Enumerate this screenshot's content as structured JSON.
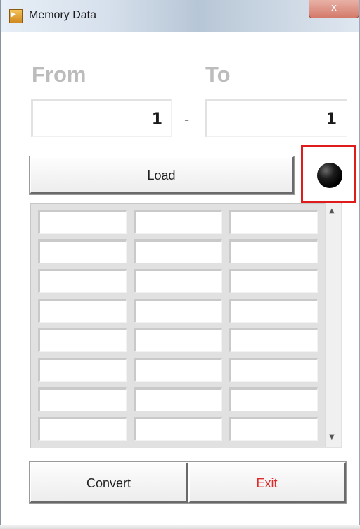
{
  "window": {
    "title": "Memory Data",
    "close_symbol": "x",
    "icon_glyph": "▶"
  },
  "range": {
    "from_label": "From",
    "to_label": "To",
    "from_value": "1",
    "to_value": "1",
    "separator": "-"
  },
  "buttons": {
    "load": "Load",
    "convert": "Convert",
    "exit": "Exit"
  },
  "indicator": {
    "state": "off",
    "color": "#000000",
    "highlight_color": "#e01b1b"
  },
  "table": {
    "columns": 3,
    "rows": [
      [
        "",
        "",
        ""
      ],
      [
        "",
        "",
        ""
      ],
      [
        "",
        "",
        ""
      ],
      [
        "",
        "",
        ""
      ],
      [
        "",
        "",
        ""
      ],
      [
        "",
        "",
        ""
      ],
      [
        "",
        "",
        ""
      ],
      [
        "",
        "",
        ""
      ]
    ],
    "scroll_up_symbol": "▲",
    "scroll_down_symbol": "▼"
  },
  "colors": {
    "exit_text": "#e02a2a",
    "label_gray": "#bcbcbc"
  }
}
